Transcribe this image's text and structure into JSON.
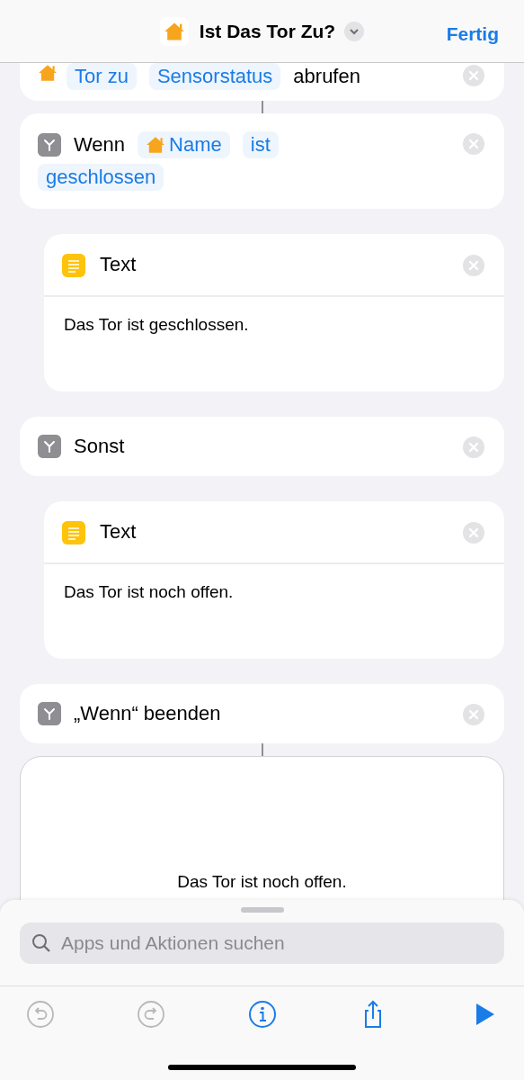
{
  "header": {
    "title": "Ist Das Tor Zu?",
    "done": "Fertig"
  },
  "actions": [
    {
      "kind": "home",
      "tokens": [
        {
          "kind": "param",
          "text": "Tor zu"
        },
        {
          "kind": "param",
          "text": "Sensorstatus"
        },
        {
          "kind": "word",
          "text": "abrufen"
        }
      ]
    },
    {
      "kind": "if",
      "tokens": [
        {
          "kind": "word",
          "text": "Wenn"
        },
        {
          "kind": "home-param",
          "text": "Name"
        },
        {
          "kind": "param",
          "text": "ist"
        },
        {
          "kind": "param",
          "text": "geschlossen"
        }
      ],
      "children": [
        {
          "kind": "text",
          "title": "Text",
          "body": "Das Tor ist geschlossen."
        }
      ]
    },
    {
      "kind": "else",
      "tokens": [
        {
          "kind": "word",
          "text": "Sonst"
        }
      ],
      "children": [
        {
          "kind": "text",
          "title": "Text",
          "body": "Das Tor ist noch offen."
        }
      ]
    },
    {
      "kind": "endif",
      "tokens": [
        {
          "kind": "word",
          "text": "„Wenn“ beenden"
        }
      ]
    },
    {
      "kind": "output",
      "body": "Das Tor ist noch offen."
    }
  ],
  "search": {
    "placeholder": "Apps und Aktionen suchen"
  },
  "toolbar": [
    {
      "kind": "undo",
      "disabled": true
    },
    {
      "kind": "redo",
      "disabled": true
    },
    {
      "kind": "info",
      "disabled": false
    },
    {
      "kind": "share",
      "disabled": false
    },
    {
      "kind": "run",
      "disabled": false
    }
  ]
}
